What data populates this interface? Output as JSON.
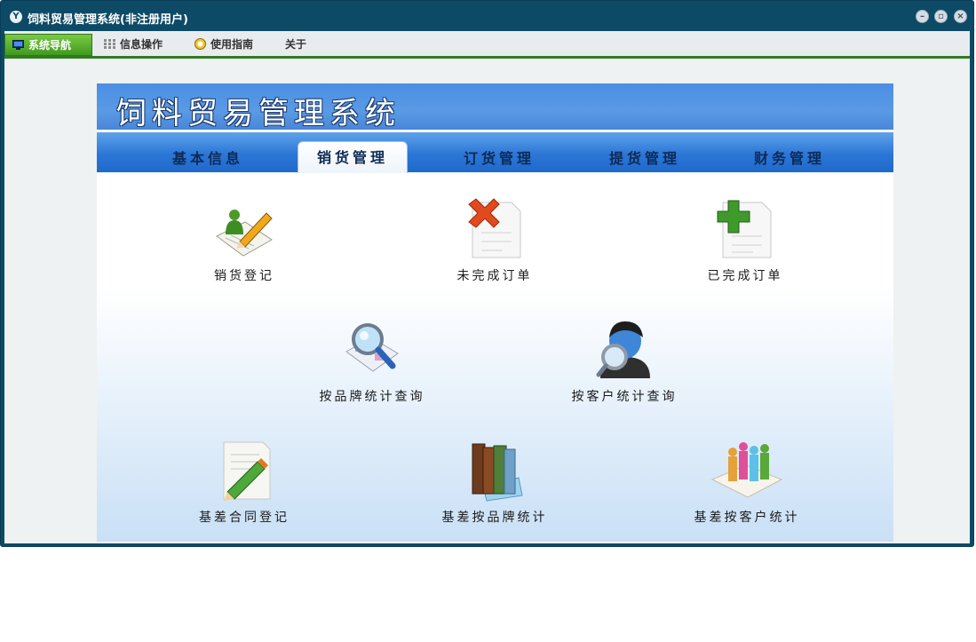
{
  "window": {
    "title": "饲料贸易管理系统(非注册用户)",
    "logo_text": "Y"
  },
  "menubar": {
    "items": [
      {
        "label": "系统导航",
        "icon": "monitor-icon",
        "active": true
      },
      {
        "label": "信息操作",
        "icon": "grid-icon",
        "active": false
      },
      {
        "label": "使用指南",
        "icon": "help-icon",
        "active": false
      },
      {
        "label": "关于",
        "icon": "",
        "active": false
      }
    ]
  },
  "banner": {
    "title": "饲料贸易管理系统"
  },
  "tabs": [
    {
      "label": "基本信息",
      "active": false
    },
    {
      "label": "销货管理",
      "active": true
    },
    {
      "label": "订货管理",
      "active": false
    },
    {
      "label": "提货管理",
      "active": false
    },
    {
      "label": "财务管理",
      "active": false
    }
  ],
  "tiles": [
    {
      "label": "销货登记",
      "icon": "sales-register-icon"
    },
    {
      "label": "未完成订单",
      "icon": "incomplete-order-icon"
    },
    {
      "label": "已完成订单",
      "icon": "completed-order-icon"
    },
    {
      "label": "按品牌统计查询",
      "icon": "brand-search-icon"
    },
    {
      "label": "按客户统计查询",
      "icon": "customer-search-icon"
    },
    {
      "label": "基差合同登记",
      "icon": "contract-register-icon"
    },
    {
      "label": "基差按品牌统计",
      "icon": "brand-stats-icon"
    },
    {
      "label": "基差按客户统计",
      "icon": "customer-stats-icon"
    }
  ],
  "colors": {
    "title_bar": "#0d4a66",
    "active_menu": "#4fa829",
    "tab_bar": "#2b76d6",
    "banner": "#5a9ae5"
  }
}
